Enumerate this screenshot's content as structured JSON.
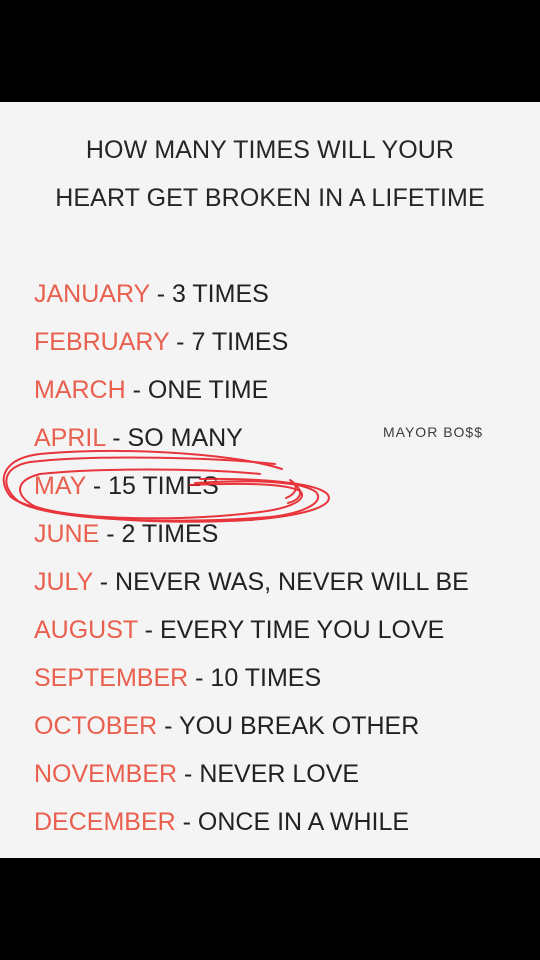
{
  "title": {
    "line1": "HOW MANY TIMES WILL YOUR",
    "line2": "HEART GET BROKEN IN A LIFETIME"
  },
  "watermark": "MAYOR BO$$",
  "months": [
    {
      "month": "JANUARY",
      "sep": " -  ",
      "answer": "3 TIMES"
    },
    {
      "month": "FEBRUARY",
      "sep": " - ",
      "answer": "7 TIMES"
    },
    {
      "month": "MARCH",
      "sep": " - ",
      "answer": "ONE TIME"
    },
    {
      "month": "APRIL",
      "sep": " - ",
      "answer": "SO MANY"
    },
    {
      "month": "MAY",
      "sep": " - ",
      "answer": "15 TIMES"
    },
    {
      "month": "JUNE",
      "sep": " - ",
      "answer": "2 TIMES"
    },
    {
      "month": "JULY",
      "sep": " - ",
      "answer": "NEVER WAS, NEVER WILL BE"
    },
    {
      "month": "AUGUST",
      "sep": " - ",
      "answer": "EVERY TIME YOU LOVE"
    },
    {
      "month": "SEPTEMBER",
      "sep": " - ",
      "answer": "10 TIMES"
    },
    {
      "month": "OCTOBER",
      "sep": " - ",
      "answer": "YOU BREAK OTHER"
    },
    {
      "month": "NOVEMBER",
      "sep": " - ",
      "answer": "NEVER LOVE"
    },
    {
      "month": "DECEMBER",
      "sep": " - ",
      "answer": "ONCE IN A WHILE"
    }
  ],
  "colors": {
    "month": "#e9604f",
    "text": "#222222",
    "scribble": "#e8242c",
    "background": "#f4f4f4"
  }
}
